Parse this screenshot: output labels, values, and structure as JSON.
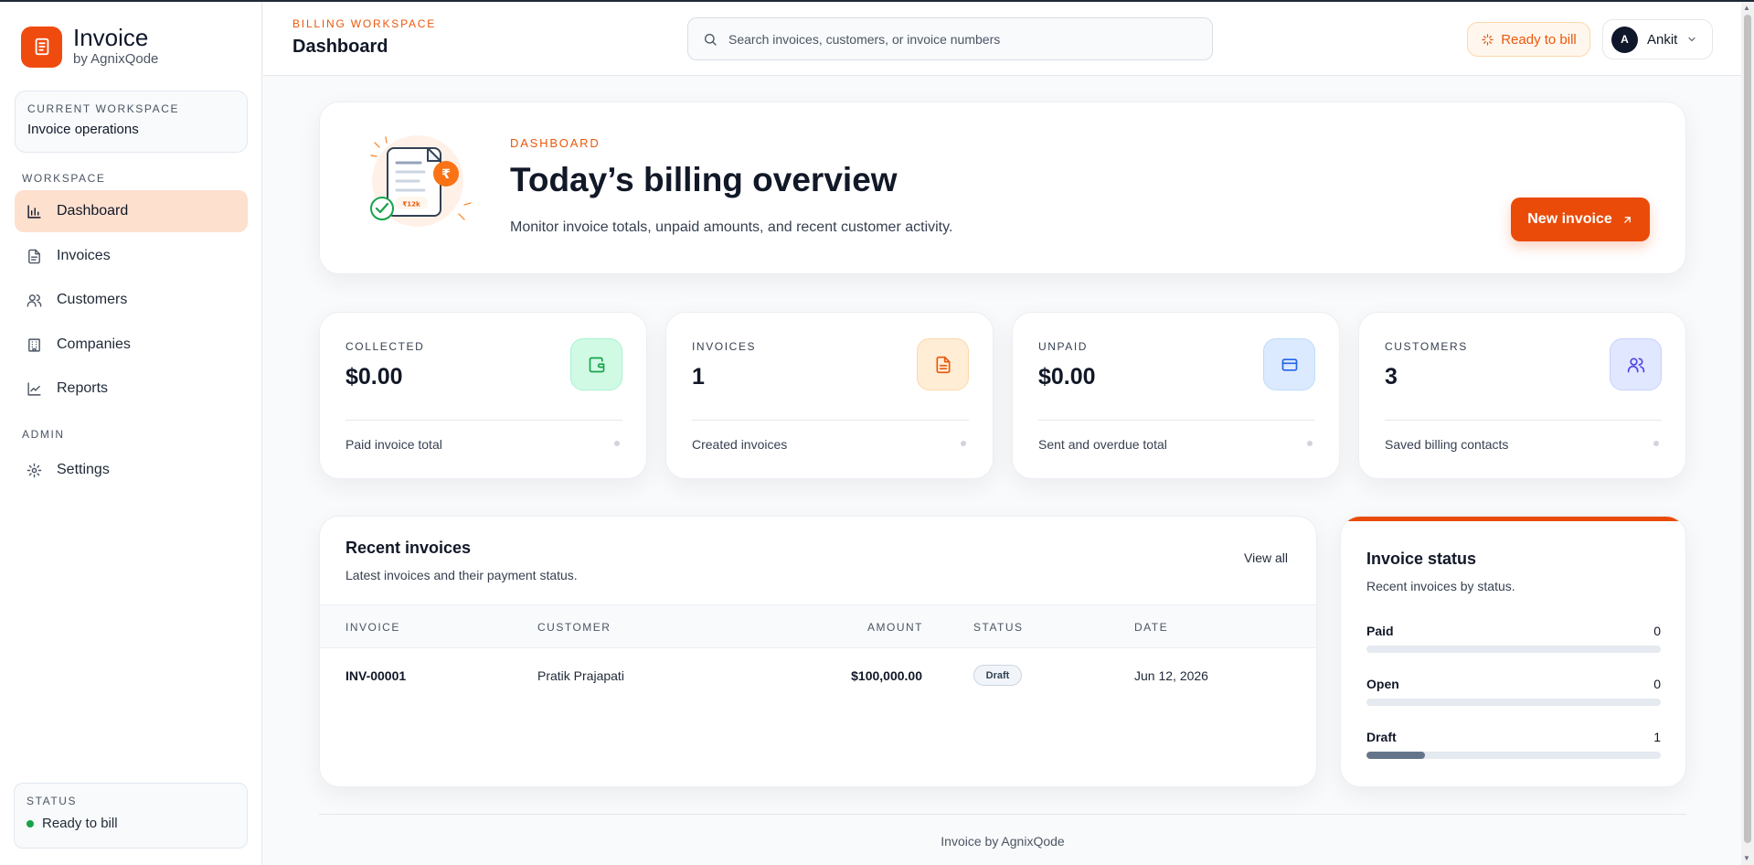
{
  "brand": {
    "title": "Invoice",
    "subtitle": "by AgnixQode"
  },
  "workspace_card": {
    "label": "CURRENT WORKSPACE",
    "value": "Invoice operations"
  },
  "sidebar": {
    "workspace_label": "WORKSPACE",
    "items": [
      {
        "label": "Dashboard",
        "icon": "bar-chart-icon",
        "active": true
      },
      {
        "label": "Invoices",
        "icon": "file-icon"
      },
      {
        "label": "Customers",
        "icon": "users-icon"
      },
      {
        "label": "Companies",
        "icon": "building-icon"
      },
      {
        "label": "Reports",
        "icon": "line-chart-icon"
      }
    ],
    "admin_label": "ADMIN",
    "admin_items": [
      {
        "label": "Settings",
        "icon": "gear-icon"
      }
    ],
    "status": {
      "label": "STATUS",
      "value": "Ready to bill"
    }
  },
  "header": {
    "kicker": "BILLING WORKSPACE",
    "title": "Dashboard",
    "search_placeholder": "Search invoices, customers, or invoice numbers",
    "ready_badge": "Ready to bill",
    "user": {
      "initial": "A",
      "name": "Ankit"
    }
  },
  "hero": {
    "kicker": "DASHBOARD",
    "title": "Today’s billing overview",
    "description": "Monitor invoice totals, unpaid amounts, and recent customer activity.",
    "button": "New invoice",
    "illustration_amount": "₹12k"
  },
  "stats": [
    {
      "label": "COLLECTED",
      "value": "$0.00",
      "desc": "Paid invoice total",
      "icon": "wallet-icon",
      "color": "#16a34a",
      "bg": "#d1fae5"
    },
    {
      "label": "INVOICES",
      "value": "1",
      "desc": "Created invoices",
      "icon": "document-icon",
      "color": "#ea580c",
      "bg": "#ffedd5"
    },
    {
      "label": "UNPAID",
      "value": "$0.00",
      "desc": "Sent and overdue total",
      "icon": "credit-card-icon",
      "color": "#2563eb",
      "bg": "#dbeafe"
    },
    {
      "label": "CUSTOMERS",
      "value": "3",
      "desc": "Saved billing contacts",
      "icon": "users-icon",
      "color": "#4f46e5",
      "bg": "#e0e7ff"
    }
  ],
  "recent": {
    "title": "Recent invoices",
    "subtitle": "Latest invoices and their payment status.",
    "view_all": "View all",
    "columns": [
      "INVOICE",
      "CUSTOMER",
      "AMOUNT",
      "STATUS",
      "DATE"
    ],
    "rows": [
      {
        "invoice": "INV-00001",
        "customer": "Pratik Prajapati",
        "amount": "$100,000.00",
        "status": "Draft",
        "date": "Jun 12, 2026"
      }
    ]
  },
  "invoice_status": {
    "title": "Invoice status",
    "subtitle": "Recent invoices by status.",
    "rows": [
      {
        "label": "Paid",
        "count": "0",
        "fraction": 0
      },
      {
        "label": "Open",
        "count": "0",
        "fraction": 0
      },
      {
        "label": "Draft",
        "count": "1",
        "fraction": 0.2
      }
    ]
  },
  "footer": "Invoice by AgnixQode",
  "colors": {
    "accent": "#ea4b09",
    "active_nav_bg": "#fee0cf",
    "status_green": "#16a34a"
  }
}
